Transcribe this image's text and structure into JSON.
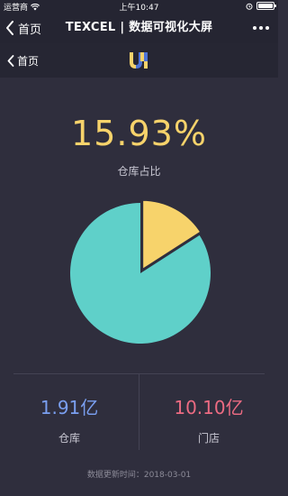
{
  "status_bar": {
    "carrier": "运营商",
    "time": "上午10:47"
  },
  "nav_bar": {
    "back_label": "首页",
    "title": "TEXCEL | 数据可视化大屏"
  },
  "app_header": {
    "back_label": "首页"
  },
  "summary": {
    "percent": "15.93%",
    "label": "仓库占比"
  },
  "chart_data": {
    "type": "pie",
    "categories": [
      "仓库",
      "门店"
    ],
    "values": [
      15.93,
      84.07
    ],
    "colors": [
      "#f7d36b",
      "#5fd0c9"
    ]
  },
  "stats": [
    {
      "value": "1.91亿",
      "label": "仓库"
    },
    {
      "value": "10.10亿",
      "label": "门店"
    }
  ],
  "footer": {
    "updated": "数据更新时间：2018-03-01"
  },
  "colors": {
    "accent_yellow": "#f7d36b",
    "pie_teal": "#5fd0c9",
    "warehouse_blue": "#7a9ff0",
    "store_pink": "#ec6b82",
    "background": "#2f2e3d"
  }
}
